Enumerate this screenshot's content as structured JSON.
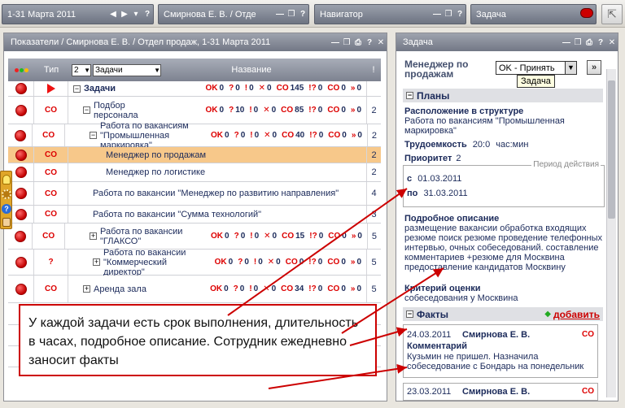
{
  "topbar": {
    "period": "1-31 Марта 2011",
    "user": "Смирнова Е. В. / Отде",
    "navigator": "Навигатор",
    "task": "Задача"
  },
  "left_panel": {
    "title": "Показатели / Смирнова Е. В. / Отдел продаж, 1-31 Марта 2011",
    "header": {
      "type": "Тип",
      "level": "2",
      "filter": "Задачи",
      "name": "Название",
      "num": "!"
    },
    "rows": [
      {
        "type": "flag",
        "name": "Задачи",
        "ok": "OK 0",
        "q": "? 0",
        "ex": "! 0",
        "x": "✕ 0",
        "co": "CO 145",
        "sq": "!? 0",
        "co2": "CO 0",
        "dbl": "» 0",
        "num": ""
      },
      {
        "type": "CO",
        "name": "Подбор персонала",
        "ok": "OK 0",
        "q": "? 10",
        "ex": "! 0",
        "x": "✕ 0",
        "co": "CO 85",
        "sq": "!? 0",
        "co2": "CO 0",
        "dbl": "» 0",
        "num": "2"
      },
      {
        "type": "CO",
        "name": "Работа по вакансиям \"Промышленная маркировка\"",
        "ok": "OK 0",
        "q": "? 0",
        "ex": "! 0",
        "x": "✕ 0",
        "co": "CO 40",
        "sq": "!? 0",
        "co2": "CO 0",
        "dbl": "» 0",
        "num": "2"
      },
      {
        "type": "CO",
        "name": "Менеджер по продажам",
        "num": "2"
      },
      {
        "type": "CO",
        "name": "Менеджер по логистике",
        "num": "2"
      },
      {
        "type": "CO",
        "name": "Работа по вакансии \"Менеджер по развитию направления\"",
        "num": "4"
      },
      {
        "type": "CO",
        "name": "Работа по вакансии \"Сумма технологий\"",
        "num": "3"
      },
      {
        "type": "CO",
        "name": "Работа по вакансии \"ГЛАКСО\"",
        "ok": "OK 0",
        "q": "? 0",
        "ex": "! 0",
        "x": "✕ 0",
        "co": "CO 15",
        "sq": "!? 0",
        "co2": "CO 0",
        "dbl": "» 0",
        "num": "5"
      },
      {
        "type": "?",
        "name": "Работа по вакансии \"Коммерческий директор\"",
        "ok": "OK 0",
        "q": "? 0",
        "ex": "! 0",
        "x": "✕ 0",
        "co": "CO 0",
        "sq": "!? 0",
        "co2": "CO 0",
        "dbl": "» 0",
        "num": "5"
      },
      {
        "type": "CO",
        "name": "Аренда зала",
        "ok": "OK 0",
        "q": "? 0",
        "ex": "! 0",
        "x": "✕ 0",
        "co": "CO 34",
        "sq": "!? 0",
        "co2": "CO 0",
        "dbl": "» 0",
        "num": "5"
      }
    ],
    "hidden_nums": [
      "3",
      "5",
      "5"
    ]
  },
  "right_panel": {
    "title": "Задача",
    "manager_label": "Менеджер по продажам",
    "status_select": "OK - Принять",
    "tooltip": "Задача",
    "plans_header": "Планы",
    "structure_label": "Расположение в структуре",
    "structure_value": "Работа по вакансиям \"Промышленная маркировка\"",
    "effort_label": "Трудоемкость",
    "effort_value": "20:0",
    "effort_unit": "час:мин",
    "priority_label": "Приоритет",
    "priority_value": "2",
    "period_label": "Период действия",
    "from_label": "с",
    "from_date": "01.03.2011",
    "to_label": "по",
    "to_date": "31.03.2011",
    "desc_label": "Подробное описание",
    "desc_text": "размещение вакансии обработка входящих резюме поиск резюме проведение телефонных интервью, очных собеседований. составление комментариев +резюме для Москвина предоставление кандидатов Москвину",
    "criteria_label": "Критерий оценки",
    "criteria_value": "собеседования у Москвина",
    "facts_header": "Факты",
    "add_link": "добавить",
    "facts": [
      {
        "date": "24.03.2011",
        "author": "Смирнова Е. В.",
        "badge": "CO",
        "label": "Комментарий",
        "text": "Кузьмин не пришел. Назначила собеседование с Бондарь на понедельник"
      },
      {
        "date": "23.03.2011",
        "author": "Смирнова Е. В.",
        "badge": "CO",
        "label": "",
        "text": ""
      }
    ]
  },
  "callout": {
    "text": "У каждой задачи есть срок выполнения, длительность в часах, подробное описание. Сотрудник ежедневно заносит факты"
  },
  "colors": {
    "accent_red": "#dd0000",
    "selected_row": "#f7c88a",
    "title_bar": "#7d8290"
  }
}
